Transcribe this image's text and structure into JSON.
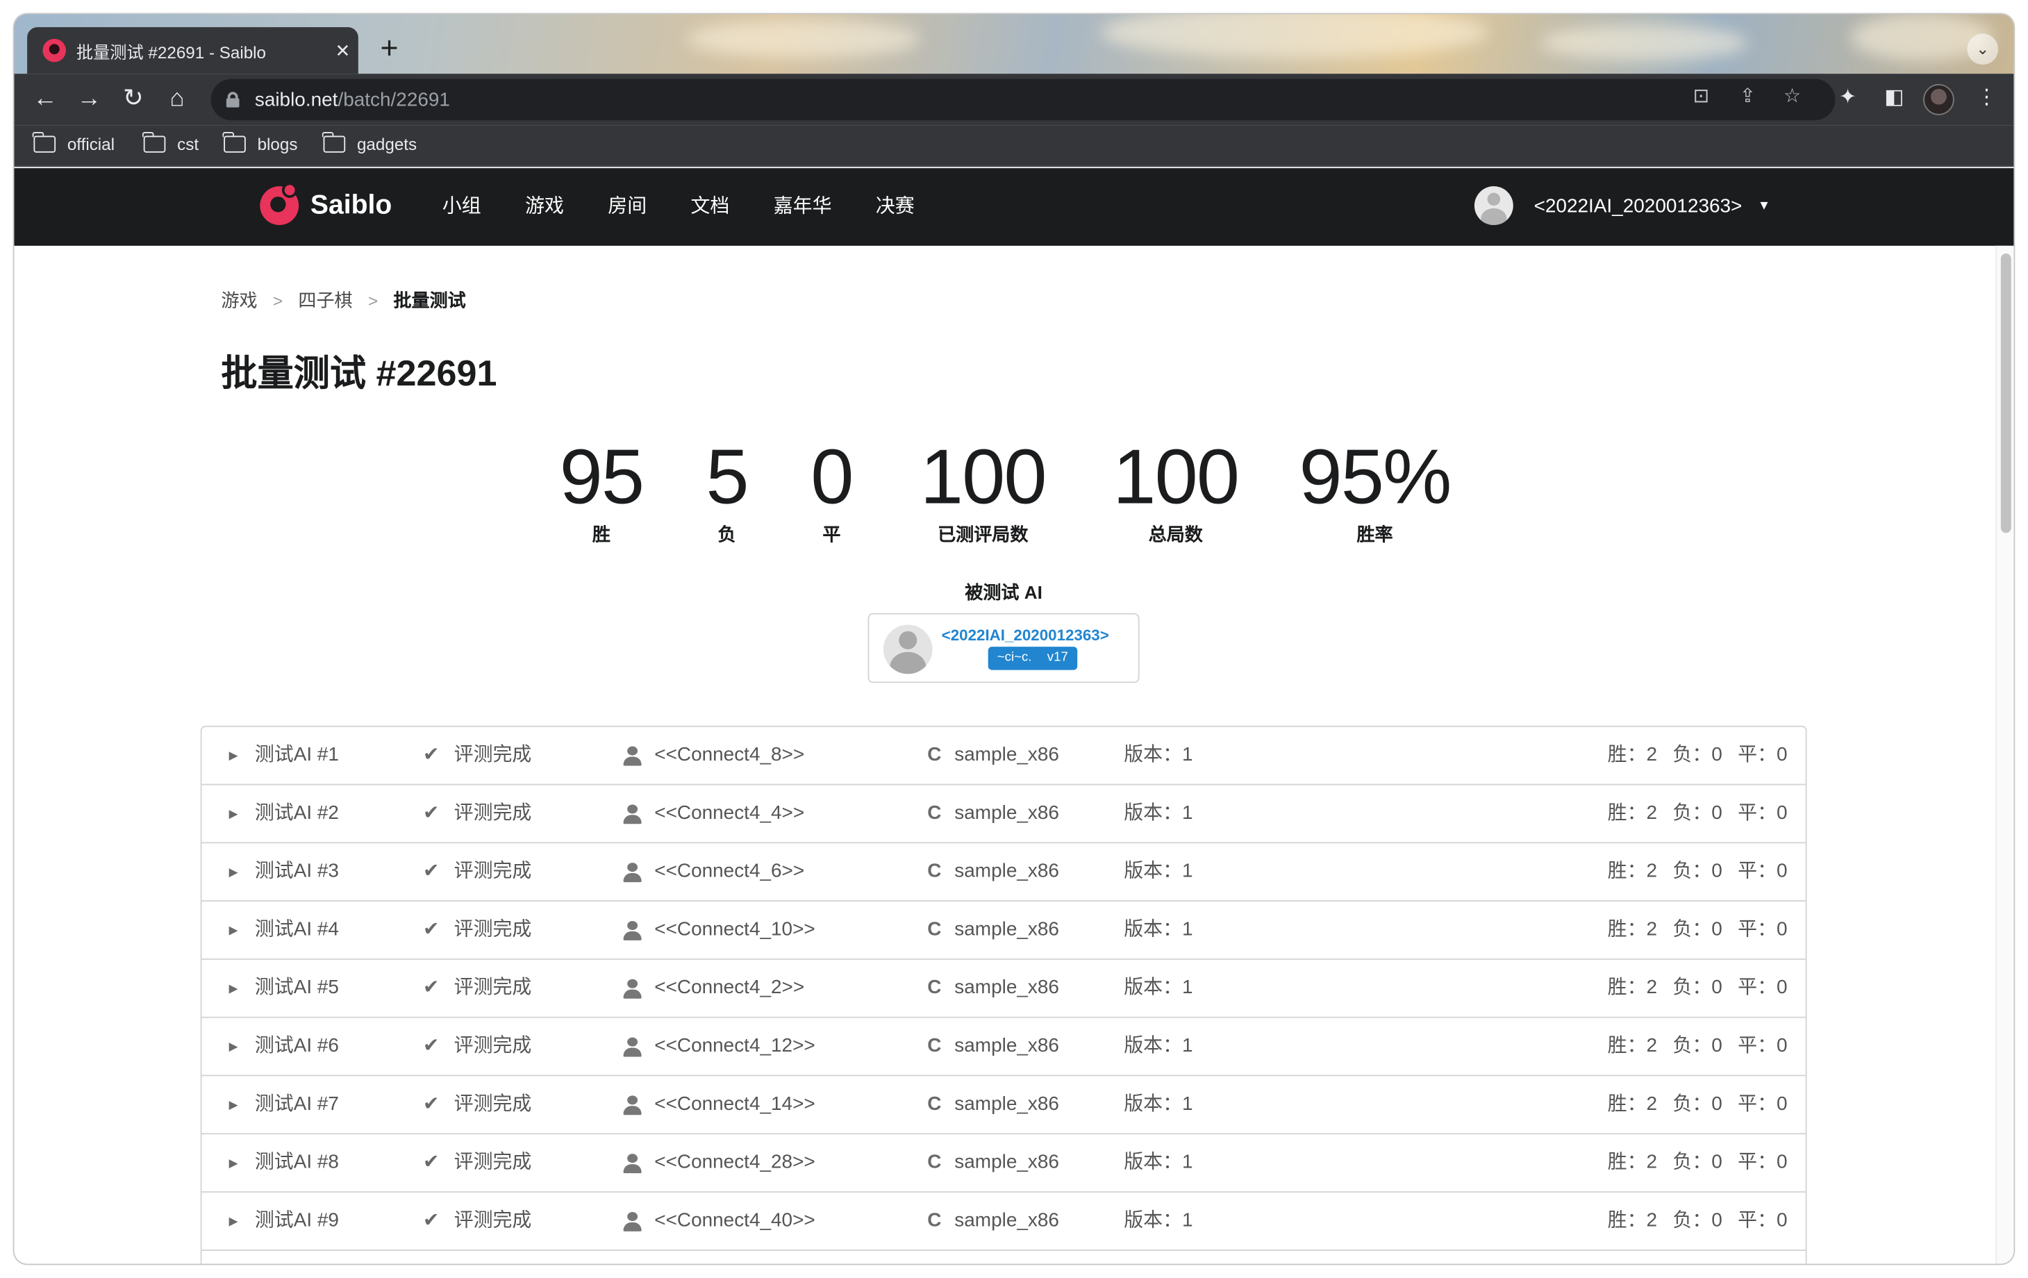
{
  "browser": {
    "tab_title": "批量测试 #22691 - Saiblo",
    "tab_close": "✕",
    "new_tab": "+",
    "url_host": "saiblo.net",
    "url_path": "/batch/22691",
    "bookmarks": [
      "official",
      "cst",
      "blogs",
      "gadgets"
    ]
  },
  "site": {
    "brand": "Saiblo",
    "menu": [
      "小组",
      "游戏",
      "房间",
      "文档",
      "嘉年华",
      "决赛"
    ],
    "user": "<2022IAI_2020012363>"
  },
  "breadcrumb": [
    "游戏",
    "四子棋",
    "批量测试"
  ],
  "title": "批量测试 #22691",
  "stats": [
    {
      "value": "95",
      "label": "胜"
    },
    {
      "value": "5",
      "label": "负"
    },
    {
      "value": "0",
      "label": "平"
    },
    {
      "value": "100",
      "label": "已测评局数"
    },
    {
      "value": "100",
      "label": "总局数"
    },
    {
      "value": "95%",
      "label": "胜率"
    }
  ],
  "tested_ai": {
    "heading": "被测试 AI",
    "name": "<2022IAI_2020012363>",
    "tag_name": "~ci~c.",
    "tag_version": "v17"
  },
  "rows": [
    {
      "name": "测试AI #1",
      "status": "评测完成",
      "owner": "<<Connect4_8>>",
      "ai": "sample_x86",
      "version": "版本：1",
      "win": "胜：2",
      "lose": "负：0",
      "draw": "平：0"
    },
    {
      "name": "测试AI #2",
      "status": "评测完成",
      "owner": "<<Connect4_4>>",
      "ai": "sample_x86",
      "version": "版本：1",
      "win": "胜：2",
      "lose": "负：0",
      "draw": "平：0"
    },
    {
      "name": "测试AI #3",
      "status": "评测完成",
      "owner": "<<Connect4_6>>",
      "ai": "sample_x86",
      "version": "版本：1",
      "win": "胜：2",
      "lose": "负：0",
      "draw": "平：0"
    },
    {
      "name": "测试AI #4",
      "status": "评测完成",
      "owner": "<<Connect4_10>>",
      "ai": "sample_x86",
      "version": "版本：1",
      "win": "胜：2",
      "lose": "负：0",
      "draw": "平：0"
    },
    {
      "name": "测试AI #5",
      "status": "评测完成",
      "owner": "<<Connect4_2>>",
      "ai": "sample_x86",
      "version": "版本：1",
      "win": "胜：2",
      "lose": "负：0",
      "draw": "平：0"
    },
    {
      "name": "测试AI #6",
      "status": "评测完成",
      "owner": "<<Connect4_12>>",
      "ai": "sample_x86",
      "version": "版本：1",
      "win": "胜：2",
      "lose": "负：0",
      "draw": "平：0"
    },
    {
      "name": "测试AI #7",
      "status": "评测完成",
      "owner": "<<Connect4_14>>",
      "ai": "sample_x86",
      "version": "版本：1",
      "win": "胜：2",
      "lose": "负：0",
      "draw": "平：0"
    },
    {
      "name": "测试AI #8",
      "status": "评测完成",
      "owner": "<<Connect4_28>>",
      "ai": "sample_x86",
      "version": "版本：1",
      "win": "胜：2",
      "lose": "负：0",
      "draw": "平：0"
    },
    {
      "name": "测试AI #9",
      "status": "评测完成",
      "owner": "<<Connect4_40>>",
      "ai": "sample_x86",
      "version": "版本：1",
      "win": "胜：2",
      "lose": "负：0",
      "draw": "平：0"
    }
  ],
  "icons": {
    "expand": "caret-right-icon",
    "status": "checkmark-icon",
    "owner": "user-icon",
    "language": "c-language-icon"
  },
  "colors": {
    "brand": "#e8335b",
    "link": "#2185d0",
    "nav_bg": "#1b1c1d",
    "chrome_bg": "#35363a"
  }
}
